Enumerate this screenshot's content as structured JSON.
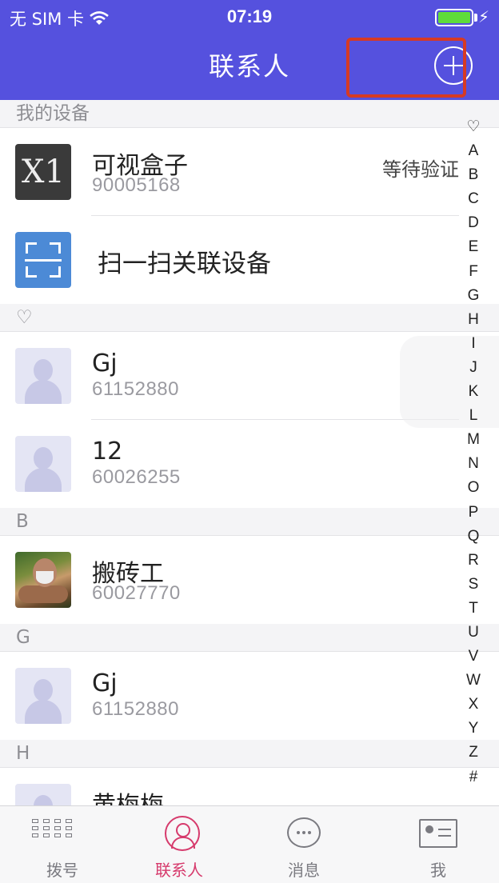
{
  "status_bar": {
    "carrier": "无 SIM 卡",
    "time": "07:19"
  },
  "nav": {
    "title": "联系人"
  },
  "sections": {
    "devices": "我的设备",
    "favorites": "♡",
    "b": "B",
    "g": "G",
    "h": "H"
  },
  "devices": [
    {
      "name": "可视盒子",
      "number": "90005168",
      "status": "等待验证",
      "avatar_text": "X1"
    },
    {
      "name": "扫一扫关联设备"
    }
  ],
  "favorites": [
    {
      "name": "Gj",
      "number": "61152880"
    },
    {
      "name": "12",
      "number": "60026255"
    }
  ],
  "b_contacts": [
    {
      "name": "搬砖工",
      "number": "60027770"
    }
  ],
  "g_contacts": [
    {
      "name": "Gj",
      "number": "61152880"
    }
  ],
  "h_contacts": [
    {
      "name": "黄梅梅"
    }
  ],
  "index": [
    "♡",
    "A",
    "B",
    "C",
    "D",
    "E",
    "F",
    "G",
    "H",
    "I",
    "J",
    "K",
    "L",
    "M",
    "N",
    "O",
    "P",
    "Q",
    "R",
    "S",
    "T",
    "U",
    "V",
    "W",
    "X",
    "Y",
    "Z",
    "#"
  ],
  "tabs": [
    {
      "label": "拨号",
      "icon": "dialpad-icon"
    },
    {
      "label": "联系人",
      "icon": "contacts-icon"
    },
    {
      "label": "消息",
      "icon": "message-icon"
    },
    {
      "label": "我",
      "icon": "profile-card-icon"
    }
  ],
  "colors": {
    "nav_background": "#5551de",
    "active_tab": "#d63a6c",
    "highlight_box": "#d63a24",
    "battery": "#5fdc3a"
  }
}
